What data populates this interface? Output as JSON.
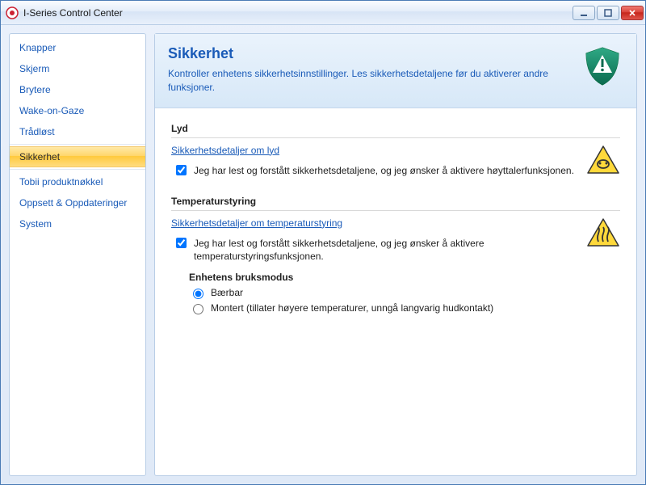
{
  "window": {
    "title": "I-Series Control Center"
  },
  "sidebar": {
    "items": [
      {
        "label": "Knapper"
      },
      {
        "label": "Skjerm"
      },
      {
        "label": "Brytere"
      },
      {
        "label": "Wake-on-Gaze"
      },
      {
        "label": "Trådløst"
      },
      {
        "label": "Sikkerhet"
      },
      {
        "label": "Tobii produktnøkkel"
      },
      {
        "label": "Oppsett & Oppdateringer"
      },
      {
        "label": "System"
      }
    ],
    "selected_index": 5
  },
  "header": {
    "title": "Sikkerhet",
    "description": "Kontroller enhetens sikkerhetsinnstillinger. Les sikkerhetsdetaljene før du aktiverer andre funksjoner."
  },
  "sections": {
    "sound": {
      "title": "Lyd",
      "link": "Sikkerhetsdetaljer om lyd",
      "checkbox_label": "Jeg har lest og forstått sikkerhetsdetaljene, og jeg ønsker å aktivere høyttalerfunksjonen.",
      "checkbox_checked": true
    },
    "temperature": {
      "title": "Temperaturstyring",
      "link": "Sikkerhetsdetaljer om temperaturstyring",
      "checkbox_label": "Jeg har lest og forstått sikkerhetsdetaljene, og jeg ønsker å aktivere temperaturstyringsfunksjonen.",
      "checkbox_checked": true,
      "mode_title": "Enhetens bruksmodus",
      "radio_options": [
        {
          "label": "Bærbar",
          "checked": true
        },
        {
          "label": "Montert (tillater høyere temperaturer, unngå langvarig hudkontakt)",
          "checked": false
        }
      ]
    }
  }
}
